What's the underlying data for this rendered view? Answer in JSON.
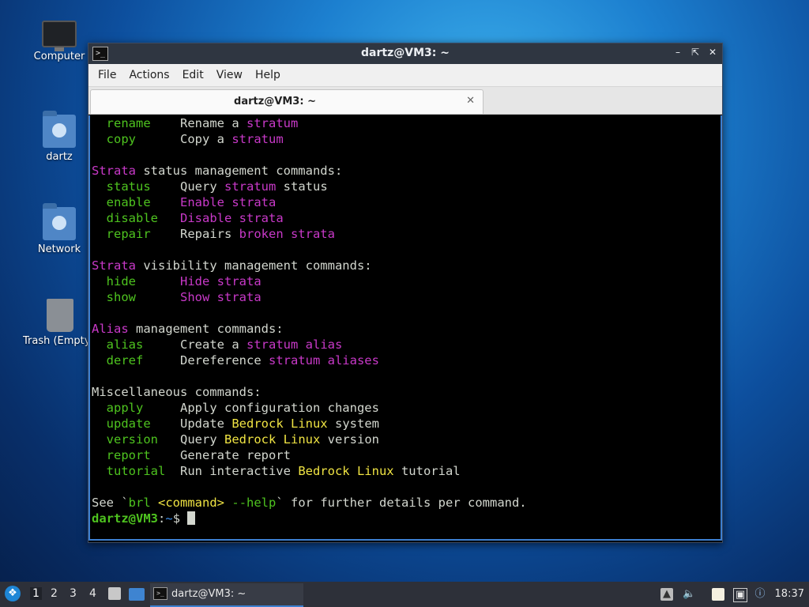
{
  "desktop": {
    "icons": [
      {
        "label": "Computer"
      },
      {
        "label": "dartz"
      },
      {
        "label": "Network"
      },
      {
        "label": "Trash (Empty)"
      }
    ]
  },
  "window": {
    "title": "dartz@VM3: ~",
    "menu": [
      "File",
      "Actions",
      "Edit",
      "View",
      "Help"
    ],
    "tab_title": "dartz@VM3: ~",
    "terminal_lines": [
      [
        {
          "t": "  "
        },
        {
          "t": "rename",
          "c": "g"
        },
        {
          "t": "    Rename a "
        },
        {
          "t": "stratum",
          "c": "m"
        }
      ],
      [
        {
          "t": "  "
        },
        {
          "t": "copy",
          "c": "g"
        },
        {
          "t": "      Copy a "
        },
        {
          "t": "stratum",
          "c": "m"
        }
      ],
      [
        {
          "t": ""
        }
      ],
      [
        {
          "t": "Strata",
          "c": "m"
        },
        {
          "t": " status management commands:"
        }
      ],
      [
        {
          "t": "  "
        },
        {
          "t": "status",
          "c": "g"
        },
        {
          "t": "    Query "
        },
        {
          "t": "stratum",
          "c": "m"
        },
        {
          "t": " status"
        }
      ],
      [
        {
          "t": "  "
        },
        {
          "t": "enable",
          "c": "g"
        },
        {
          "t": "    "
        },
        {
          "t": "Enable strata",
          "c": "m"
        }
      ],
      [
        {
          "t": "  "
        },
        {
          "t": "disable",
          "c": "g"
        },
        {
          "t": "   "
        },
        {
          "t": "Disable strata",
          "c": "m"
        }
      ],
      [
        {
          "t": "  "
        },
        {
          "t": "repair",
          "c": "g"
        },
        {
          "t": "    Repairs "
        },
        {
          "t": "broken strata",
          "c": "m"
        }
      ],
      [
        {
          "t": ""
        }
      ],
      [
        {
          "t": "Strata",
          "c": "m"
        },
        {
          "t": " visibility management commands:"
        }
      ],
      [
        {
          "t": "  "
        },
        {
          "t": "hide",
          "c": "g"
        },
        {
          "t": "      "
        },
        {
          "t": "Hide strata",
          "c": "m"
        }
      ],
      [
        {
          "t": "  "
        },
        {
          "t": "show",
          "c": "g"
        },
        {
          "t": "      "
        },
        {
          "t": "Show strata",
          "c": "m"
        }
      ],
      [
        {
          "t": ""
        }
      ],
      [
        {
          "t": "Alias",
          "c": "m"
        },
        {
          "t": " management commands:"
        }
      ],
      [
        {
          "t": "  "
        },
        {
          "t": "alias",
          "c": "g"
        },
        {
          "t": "     Create a "
        },
        {
          "t": "stratum alias",
          "c": "m"
        }
      ],
      [
        {
          "t": "  "
        },
        {
          "t": "deref",
          "c": "g"
        },
        {
          "t": "     Dereference "
        },
        {
          "t": "stratum aliases",
          "c": "m"
        }
      ],
      [
        {
          "t": ""
        }
      ],
      [
        {
          "t": "Miscellaneous commands:"
        }
      ],
      [
        {
          "t": "  "
        },
        {
          "t": "apply",
          "c": "g"
        },
        {
          "t": "     Apply configuration changes"
        }
      ],
      [
        {
          "t": "  "
        },
        {
          "t": "update",
          "c": "g"
        },
        {
          "t": "    Update "
        },
        {
          "t": "Bedrock Linux",
          "c": "y"
        },
        {
          "t": " system"
        }
      ],
      [
        {
          "t": "  "
        },
        {
          "t": "version",
          "c": "g"
        },
        {
          "t": "   Query "
        },
        {
          "t": "Bedrock Linux",
          "c": "y"
        },
        {
          "t": " version"
        }
      ],
      [
        {
          "t": "  "
        },
        {
          "t": "report",
          "c": "g"
        },
        {
          "t": "    Generate report"
        }
      ],
      [
        {
          "t": "  "
        },
        {
          "t": "tutorial",
          "c": "g"
        },
        {
          "t": "  Run interactive "
        },
        {
          "t": "Bedrock Linux",
          "c": "y"
        },
        {
          "t": " tutorial"
        }
      ],
      [
        {
          "t": ""
        }
      ],
      [
        {
          "t": "See `"
        },
        {
          "t": "brl",
          "c": "g"
        },
        {
          "t": " "
        },
        {
          "t": "<command>",
          "c": "y"
        },
        {
          "t": " "
        },
        {
          "t": "--help",
          "c": "g"
        },
        {
          "t": "` for further details per command."
        }
      ]
    ],
    "prompt": {
      "user_host": "dartz@VM3",
      "sep": ":",
      "path": "~",
      "symbol": "$ "
    }
  },
  "taskbar": {
    "workspaces": [
      "1",
      "2",
      "3",
      "4"
    ],
    "active_workspace": "1",
    "task_label": "dartz@VM3: ~",
    "clock": "18:37"
  },
  "colors": {
    "command_green": "#4ec31f",
    "stratum_magenta": "#c839c8",
    "bedrock_yellow": "#f0e443",
    "path_blue": "#3b8eea"
  }
}
